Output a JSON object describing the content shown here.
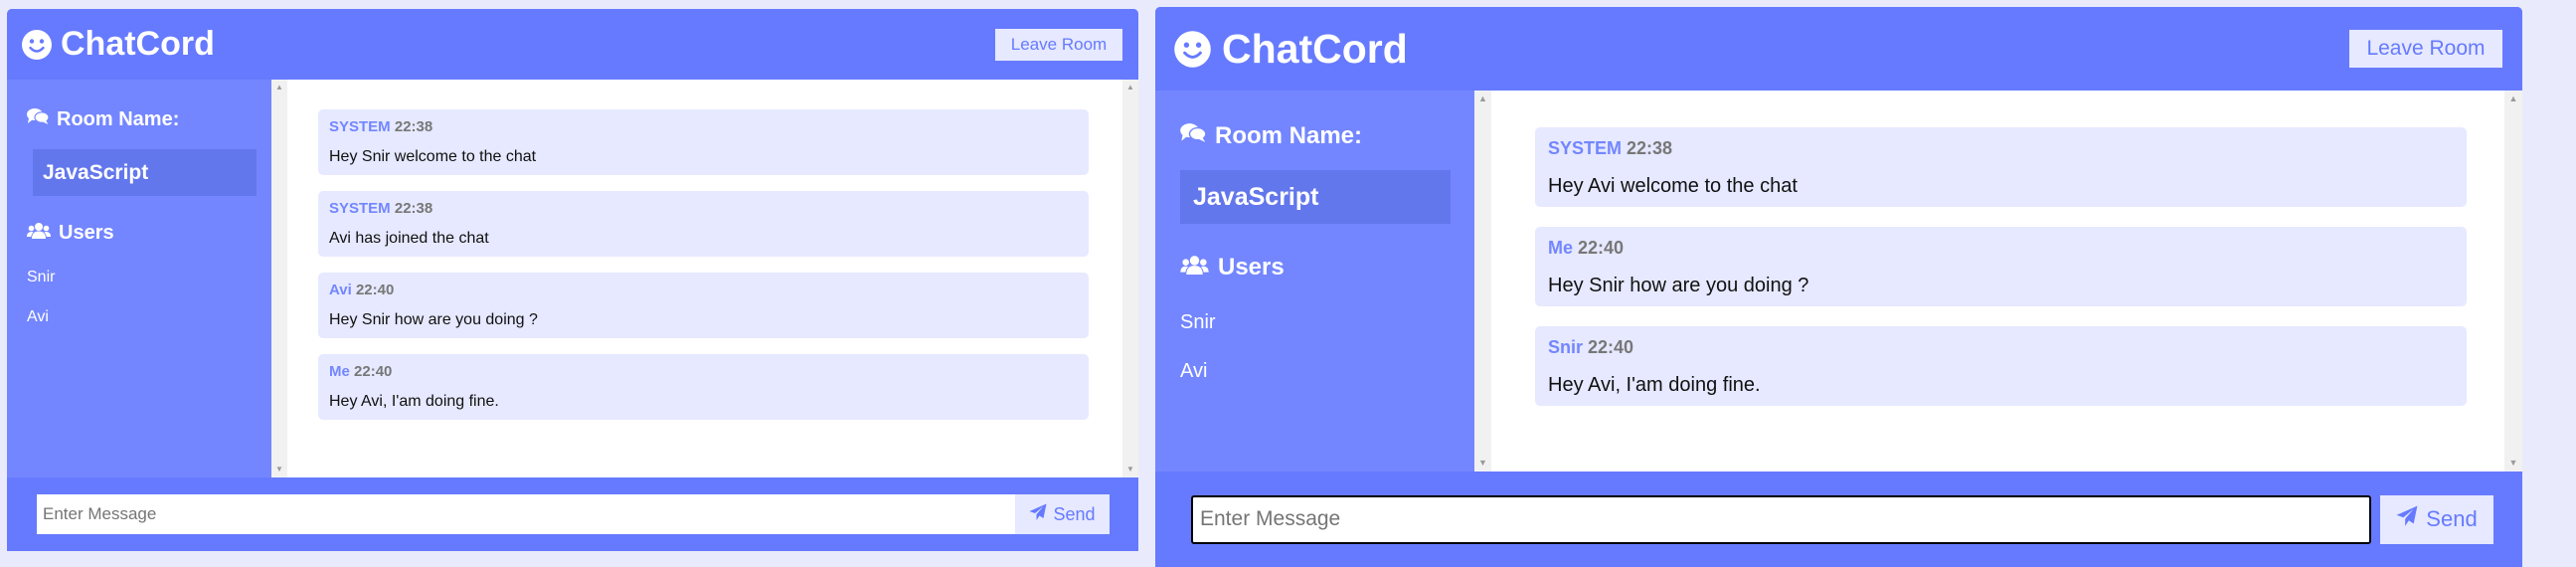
{
  "app": {
    "brand": "ChatCord",
    "leave_label": "Leave Room",
    "room_heading": "Room Name:",
    "users_heading": "Users",
    "send_label": "Send",
    "input_placeholder": "Enter Message",
    "colors": {
      "primary": "#667aff",
      "sidebar": "#7386ff",
      "message_bg": "#e6e9ff",
      "room_box": "#6377ec"
    },
    "icons": {
      "brand": "smile-icon",
      "room": "comments-icon",
      "users": "users-icon",
      "send": "paper-plane-icon"
    }
  },
  "panels": [
    {
      "room_name": "JavaScript",
      "users": [
        "Snir",
        "Avi"
      ],
      "messages": [
        {
          "author": "SYSTEM",
          "time": "22:38",
          "text": "Hey Snir welcome to the chat"
        },
        {
          "author": "SYSTEM",
          "time": "22:38",
          "text": "Avi has joined the chat"
        },
        {
          "author": "Avi",
          "time": "22:40",
          "text": "Hey Snir how are you doing ?"
        },
        {
          "author": "Me",
          "time": "22:40",
          "text": "Hey Avi, I'am doing fine."
        }
      ]
    },
    {
      "room_name": "JavaScript",
      "users": [
        "Snir",
        "Avi"
      ],
      "messages": [
        {
          "author": "SYSTEM",
          "time": "22:38",
          "text": "Hey Avi welcome to the chat"
        },
        {
          "author": "Me",
          "time": "22:40",
          "text": "Hey Snir how are you doing ?"
        },
        {
          "author": "Snir",
          "time": "22:40",
          "text": "Hey Avi, I'am doing fine."
        }
      ]
    }
  ]
}
